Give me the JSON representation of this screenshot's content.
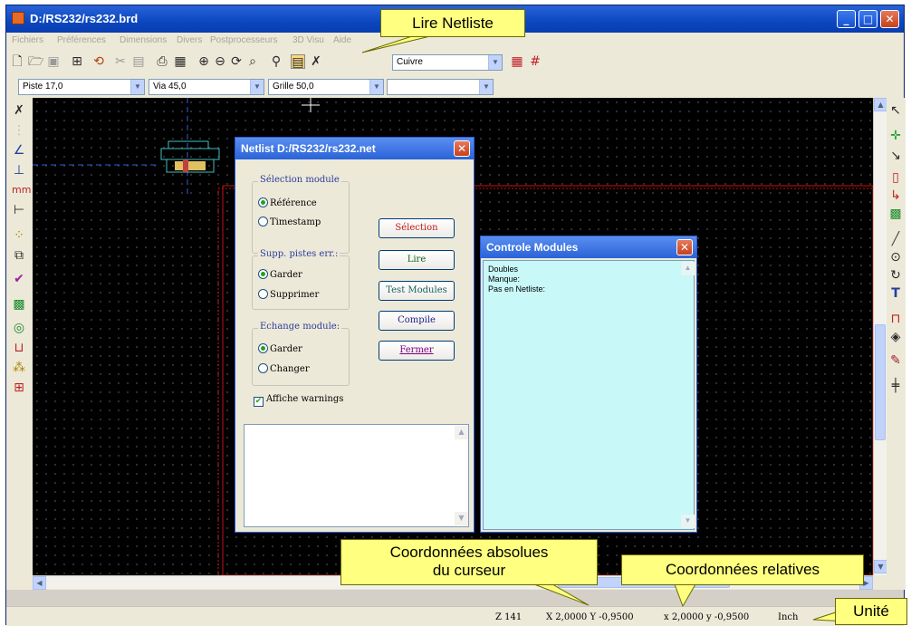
{
  "window": {
    "title": "D:/RS232/rs232.brd"
  },
  "menu": [
    "Fichiers",
    "Préférences",
    "Dimensions",
    "Divers",
    "Postprocesseurs",
    "3D Visu",
    "Aide"
  ],
  "toolbar": {
    "layer_combo": "Cuivre",
    "track_combo": "Piste 17,0",
    "via_combo": "Via 45,0",
    "grid_combo": "Grille 50,0",
    "zoom_combo": ""
  },
  "netlist_dialog": {
    "title": "Netlist D:/RS232/rs232.net",
    "select_group": "Sélection module",
    "opt_reference": "Référence",
    "opt_timestamp": "Timestamp",
    "tracks_group": "Supp. pistes err.:",
    "opt_keep": "Garder",
    "opt_delete": "Supprimer",
    "exchange_group": "Echange module:",
    "opt_keep2": "Garder",
    "opt_change": "Changer",
    "warnings": "Affiche warnings",
    "btn_select": "Sélection",
    "btn_read": "Lire",
    "btn_test": "Test Modules",
    "btn_compile": "Compile",
    "btn_close": "Fermer"
  },
  "modules_dialog": {
    "title": "Controle Modules",
    "lines": [
      "Doubles",
      "Manque:",
      "Pas en Netliste:"
    ]
  },
  "status": {
    "zoom": "Z 141",
    "abs": "X 2,0000  Y -0,9500",
    "rel": "x 2,0000  y -0,9500",
    "unit": "Inch"
  },
  "callouts": {
    "read_netlist": "Lire Netliste",
    "abs_coords_1": "Coordonnées absolues",
    "abs_coords_2": "du curseur",
    "rel_coords": "Coordonnées relatives",
    "unit": "Unité"
  },
  "colors": {
    "accent": "#2a63d8",
    "callout": "#ffff80",
    "canvas": "#000000",
    "board_edge": "#c81414",
    "modules_bg": "#c8f8f8"
  }
}
